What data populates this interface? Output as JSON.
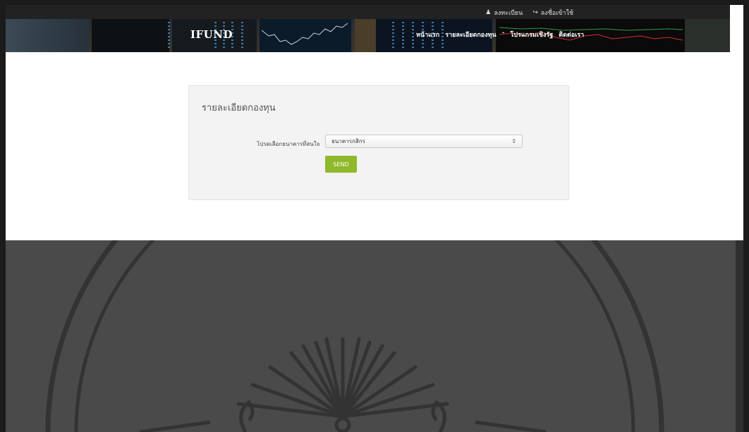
{
  "topbar": {
    "register_label": "ลงทะเบียน",
    "login_label": "ลงชื่อเข้าใช้",
    "register_icon": "user-icon",
    "login_icon": "login-icon"
  },
  "header": {
    "logo": "IFUND",
    "nav": [
      {
        "label": "หน้าแรก"
      },
      {
        "label": "รายละเอียดกองทุน"
      },
      {
        "label": "โปรแกรมเชิงรัฐ"
      },
      {
        "label": "ติดต่อเรา"
      }
    ]
  },
  "form": {
    "title": "รายละเอียดกองทุน",
    "bank_label": "โปรดเลือกธนาคารที่สนใจ",
    "bank_selected": "ธนาคารกสิกร",
    "send_label": "SEND"
  },
  "colors": {
    "accent_green": "#8fb82a",
    "footer_bg": "#4a4a4a",
    "card_bg": "#f3f3f3"
  }
}
